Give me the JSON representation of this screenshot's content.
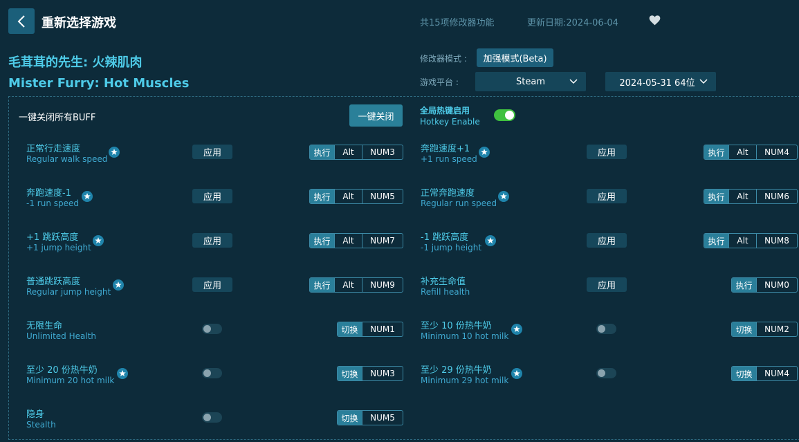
{
  "header": {
    "back_label": "",
    "title": "重新选择游戏",
    "feature_count": "共15项修改器功能",
    "update_date": "更新日期:2024-06-04"
  },
  "game": {
    "title_cn": "毛茸茸的先生: 火辣肌肉",
    "title_en": "Mister Furry: Hot Muscles"
  },
  "mode": {
    "label": "修改器模式 :",
    "value": "加强模式(Beta)"
  },
  "platform": {
    "label": "游戏平台 :",
    "value": "Steam",
    "version": "2024-05-31 64位"
  },
  "panel": {
    "buff_label": "一键关闭所有BUFF",
    "close_all": "一键关闭",
    "hotkey_cn": "全局热键启用",
    "hotkey_en": "Hotkey Enable",
    "hotkey_enabled": true
  },
  "labels": {
    "apply": "应用",
    "exec": "执行",
    "toggle": "切换",
    "alt": "Alt"
  },
  "cheats": [
    {
      "cn": "正常行走速度",
      "en": "Regular walk speed",
      "star": true,
      "type": "apply",
      "keys": [
        "执行",
        "Alt",
        "NUM3"
      ]
    },
    {
      "cn": "奔跑速度+1",
      "en": "+1 run speed",
      "star": true,
      "type": "apply",
      "keys": [
        "执行",
        "Alt",
        "NUM4"
      ]
    },
    {
      "cn": "奔跑速度-1",
      "en": "-1 run speed",
      "star": true,
      "type": "apply",
      "keys": [
        "执行",
        "Alt",
        "NUM5"
      ]
    },
    {
      "cn": "正常奔跑速度",
      "en": "Regular run speed",
      "star": true,
      "type": "apply",
      "keys": [
        "执行",
        "Alt",
        "NUM6"
      ]
    },
    {
      "cn": "+1 跳跃高度",
      "en": "+1 jump height",
      "star": true,
      "type": "apply",
      "keys": [
        "执行",
        "Alt",
        "NUM7"
      ]
    },
    {
      "cn": "-1 跳跃高度",
      "en": "-1 jump height",
      "star": true,
      "type": "apply",
      "keys": [
        "执行",
        "Alt",
        "NUM8"
      ]
    },
    {
      "cn": "普通跳跃高度",
      "en": "Regular jump height",
      "star": true,
      "type": "apply",
      "keys": [
        "执行",
        "Alt",
        "NUM9"
      ]
    },
    {
      "cn": "补充生命值",
      "en": "Refill health",
      "star": false,
      "type": "apply",
      "keys": [
        "执行",
        "NUM0"
      ]
    },
    {
      "cn": "无限生命",
      "en": "Unlimited Health",
      "star": false,
      "type": "toggle",
      "keys": [
        "切换",
        "NUM1"
      ]
    },
    {
      "cn": "至少 10 份热牛奶",
      "en": "Minimum 10 hot milk",
      "star": true,
      "type": "toggle",
      "keys": [
        "切换",
        "NUM2"
      ]
    },
    {
      "cn": "至少 20 份热牛奶",
      "en": "Minimum 20 hot milk",
      "star": true,
      "type": "toggle",
      "keys": [
        "切换",
        "NUM3"
      ]
    },
    {
      "cn": "至少 29 份热牛奶",
      "en": "Minimum 29 hot milk",
      "star": true,
      "type": "toggle",
      "keys": [
        "切换",
        "NUM4"
      ]
    },
    {
      "cn": "隐身",
      "en": "Stealth",
      "star": false,
      "type": "toggle",
      "keys": [
        "切换",
        "NUM5"
      ]
    }
  ]
}
